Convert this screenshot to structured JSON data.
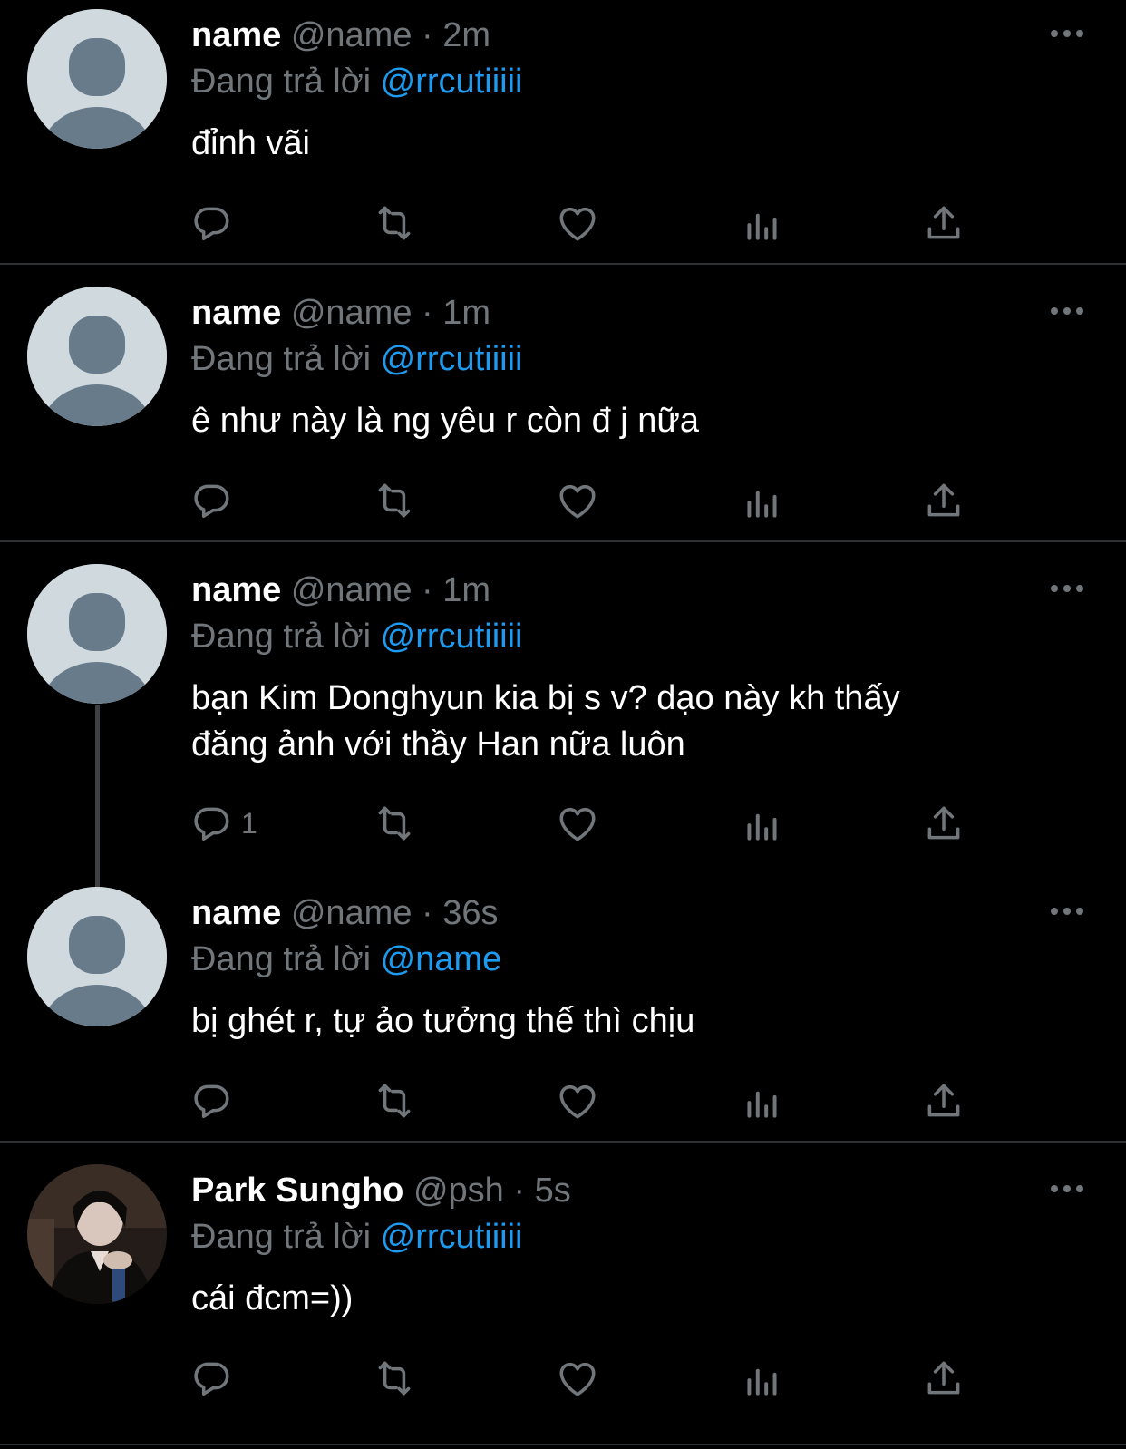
{
  "tweets": [
    {
      "name": "name",
      "handle": "@name",
      "dot": " · ",
      "time": "2m",
      "reply_prefix": "Đang trả lời ",
      "reply_to": "@rrcutiiiii",
      "text": "đỉnh vãi",
      "reply_count": ""
    },
    {
      "name": "name",
      "handle": "@name",
      "dot": " · ",
      "time": "1m",
      "reply_prefix": "Đang trả lời ",
      "reply_to": "@rrcutiiiii",
      "text": "ê như này là ng yêu r còn đ j nữa",
      "reply_count": ""
    },
    {
      "name": "name",
      "handle": "@name",
      "dot": " · ",
      "time": "1m",
      "reply_prefix": "Đang trả lời ",
      "reply_to": "@rrcutiiiii",
      "text_line1": "bạn Kim Donghyun kia bị s v? dạo này kh thấy",
      "text_line2": "đăng ảnh với thầy Han nữa luôn",
      "reply_count": "1"
    },
    {
      "name": "name",
      "handle": "@name",
      "dot": " · ",
      "time": "36s",
      "reply_prefix": "Đang trả lời ",
      "reply_to": "@name",
      "text": "bị ghét r, tự ảo tưởng thế thì chịu",
      "reply_count": ""
    },
    {
      "name": "Park Sungho",
      "handle": "@psh",
      "dot": " · ",
      "time": "5s",
      "reply_prefix": "Đang trả lời ",
      "reply_to": "@rrcutiiiii",
      "text": "cái đcm=))",
      "reply_count": ""
    }
  ],
  "icons": {
    "reply": "reply-icon",
    "retweet": "retweet-icon",
    "like": "heart-icon",
    "views": "views-icon",
    "share": "share-icon",
    "more": "more-icon"
  },
  "colors": {
    "background": "#000000",
    "primary_text": "#ffffff",
    "secondary_text": "#71767b",
    "mention": "#1d9bf0",
    "divider": "#2f3336",
    "avatar_placeholder": "#cfd9de",
    "avatar_figure": "#687b8a"
  }
}
